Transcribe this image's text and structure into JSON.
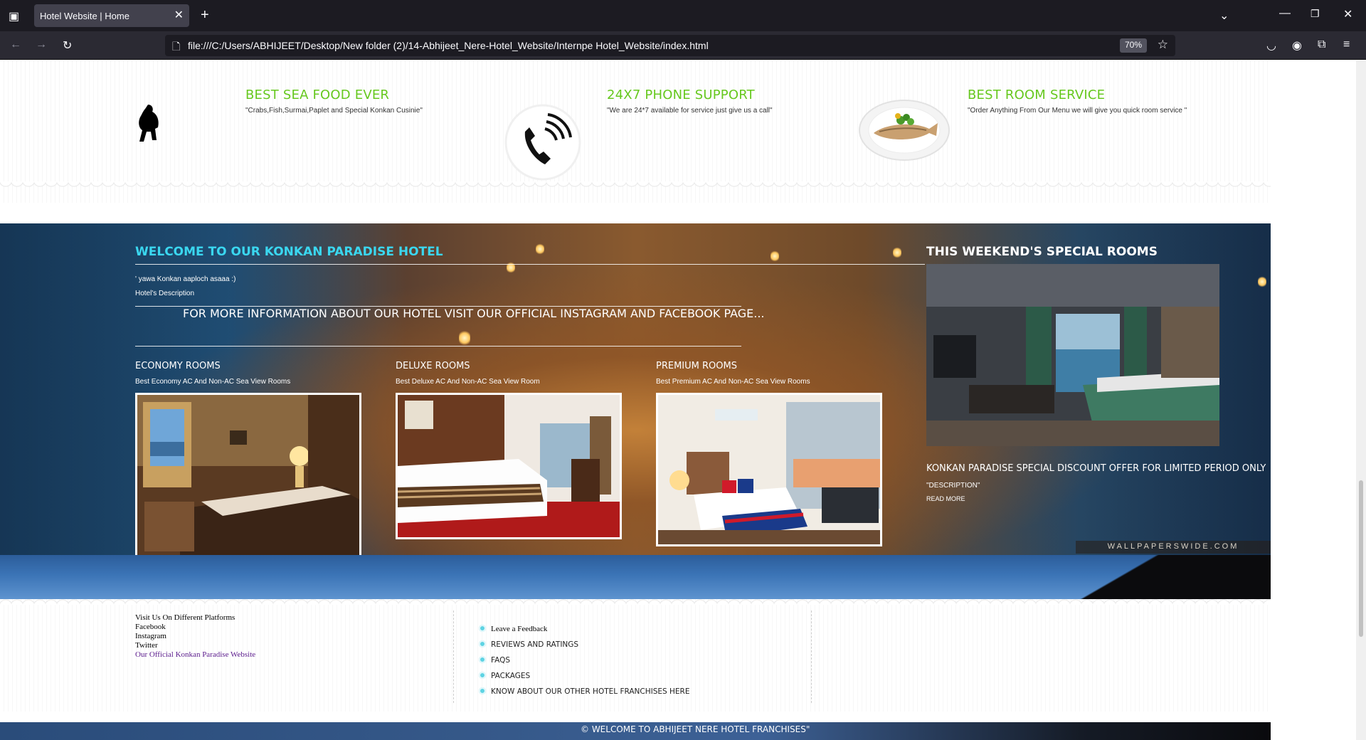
{
  "browser": {
    "tab_title": "Hotel Website | Home",
    "url": "file:///C:/Users/ABHIJEET/Desktop/New folder (2)/14-Abhijeet_Nere-Hotel_Website/Internpe Hotel_Website/index.html",
    "zoom": "70%"
  },
  "features": [
    {
      "title": "BEST SEA FOOD EVER",
      "text": "\"Crabs,Fish,Surmai,Paplet and Special Konkan Cusinie\""
    },
    {
      "title": "24X7 PHONE SUPPORT",
      "text": "\"We are 24*7 available for service just give us a call\""
    },
    {
      "title": "BEST ROOM SERVICE",
      "text": "\"Order Anything From Our Menu we will give you quick room service \""
    }
  ],
  "welcome": {
    "heading": "WELCOME TO OUR KONKAN PARADISE HOTEL",
    "tagline": "' yawa Konkan aaploch asaaa :)",
    "description": "Hotel's Description",
    "info": "FOR MORE INFORMATION ABOUT OUR HOTEL VISIT OUR OFFICIAL INSTAGRAM AND FACEBOOK PAGE..."
  },
  "rooms": [
    {
      "title": "ECONOMY ROOMS",
      "text": "Best Economy AC And Non-AC Sea View Rooms"
    },
    {
      "title": "DELUXE ROOMS",
      "text": "Best Deluxe AC And Non-AC Sea View Room"
    },
    {
      "title": "PREMIUM ROOMS",
      "text": "Best Premium AC And Non-AC Sea View Rooms"
    }
  ],
  "special": {
    "heading": "THIS WEEKEND'S SPECIAL ROOMS",
    "title": "KONKAN PARADISE SPECIAL DISCOUNT OFFER FOR LIMITED PERIOD ONLY",
    "description": "\"DESCRIPTION\"",
    "read_more": "READ MORE",
    "watermark": "WALLPAPERSWIDE.COM"
  },
  "footer": {
    "platforms_heading": "Visit Us On Different Platforms",
    "links": [
      "Facebook",
      "Instagram",
      "Twitter"
    ],
    "official_link": "Our Official Konkan Paradise Website",
    "menu": [
      "Leave a Feedback",
      "REVIEWS AND RATINGS",
      "FAQS",
      "PACKAGES",
      "KNOW ABOUT OUR OTHER HOTEL FRANCHISES HERE"
    ],
    "copyright": "© WELCOME TO ABHIJEET NERE HOTEL FRANCHISES\""
  }
}
